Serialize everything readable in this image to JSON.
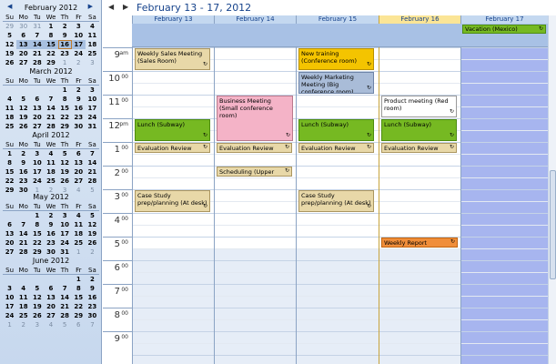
{
  "mini_calendars": [
    {
      "title": "February 2012",
      "dow": [
        "Su",
        "Mo",
        "Tu",
        "We",
        "Th",
        "Fr",
        "Sa"
      ],
      "days": [
        "29",
        "30",
        "31",
        "1",
        "2",
        "3",
        "4",
        "5",
        "6",
        "7",
        "8",
        "9",
        "10",
        "11",
        "12",
        "13",
        "14",
        "15",
        "16",
        "17",
        "18",
        "19",
        "20",
        "21",
        "22",
        "23",
        "24",
        "25",
        "26",
        "27",
        "28",
        "29",
        "1",
        "2",
        "3"
      ],
      "other_month_idx": [
        0,
        1,
        2,
        32,
        33,
        34
      ],
      "selected_idx": [
        15,
        16,
        17,
        18,
        19
      ],
      "today_idx": [
        18
      ]
    },
    {
      "title": "March 2012",
      "dow": [
        "Su",
        "Mo",
        "Tu",
        "We",
        "Th",
        "Fr",
        "Sa"
      ],
      "days": [
        "",
        "",
        "",
        "",
        "1",
        "2",
        "3",
        "4",
        "5",
        "6",
        "7",
        "8",
        "9",
        "10",
        "11",
        "12",
        "13",
        "14",
        "15",
        "16",
        "17",
        "18",
        "19",
        "20",
        "21",
        "22",
        "23",
        "24",
        "25",
        "26",
        "27",
        "28",
        "29",
        "30",
        "31"
      ],
      "other_month_idx": [],
      "selected_idx": [],
      "today_idx": []
    },
    {
      "title": "April 2012",
      "dow": [
        "Su",
        "Mo",
        "Tu",
        "We",
        "Th",
        "Fr",
        "Sa"
      ],
      "days": [
        "1",
        "2",
        "3",
        "4",
        "5",
        "6",
        "7",
        "8",
        "9",
        "10",
        "11",
        "12",
        "13",
        "14",
        "15",
        "16",
        "17",
        "18",
        "19",
        "20",
        "21",
        "22",
        "23",
        "24",
        "25",
        "26",
        "27",
        "28",
        "29",
        "30",
        "1",
        "2",
        "3",
        "4",
        "5"
      ],
      "other_month_idx": [
        30,
        31,
        32,
        33,
        34
      ],
      "selected_idx": [],
      "today_idx": []
    },
    {
      "title": "May 2012",
      "dow": [
        "Su",
        "Mo",
        "Tu",
        "We",
        "Th",
        "Fr",
        "Sa"
      ],
      "days": [
        "",
        "",
        "1",
        "2",
        "3",
        "4",
        "5",
        "6",
        "7",
        "8",
        "9",
        "10",
        "11",
        "12",
        "13",
        "14",
        "15",
        "16",
        "17",
        "18",
        "19",
        "20",
        "21",
        "22",
        "23",
        "24",
        "25",
        "26",
        "27",
        "28",
        "29",
        "30",
        "31",
        "1",
        "2"
      ],
      "other_month_idx": [
        33,
        34
      ],
      "selected_idx": [],
      "today_idx": []
    },
    {
      "title": "June 2012",
      "dow": [
        "Su",
        "Mo",
        "Tu",
        "We",
        "Th",
        "Fr",
        "Sa"
      ],
      "days": [
        "",
        "",
        "",
        "",
        "",
        "1",
        "2",
        "3",
        "4",
        "5",
        "6",
        "7",
        "8",
        "9",
        "10",
        "11",
        "12",
        "13",
        "14",
        "15",
        "16",
        "17",
        "18",
        "19",
        "20",
        "21",
        "22",
        "23",
        "24",
        "25",
        "26",
        "27",
        "28",
        "29",
        "30",
        "1",
        "2",
        "3",
        "4",
        "5",
        "6",
        "7"
      ],
      "other_month_idx": [
        35,
        36,
        37,
        38,
        39,
        40,
        41
      ],
      "selected_idx": [],
      "today_idx": []
    }
  ],
  "header": {
    "range": "February 13 - 17, 2012",
    "prev_icon": "prev-arrow-icon",
    "next_icon": "next-arrow-icon"
  },
  "days": [
    {
      "label": "February 13",
      "today": false
    },
    {
      "label": "February 14",
      "today": false
    },
    {
      "label": "February 15",
      "today": false
    },
    {
      "label": "February 16",
      "today": true
    },
    {
      "label": "February 17",
      "today": false
    }
  ],
  "allday_event": {
    "title": "Vacation (Mexico)",
    "day": 4
  },
  "hours": [
    {
      "h": "9",
      "m": "am"
    },
    {
      "h": "10",
      "m": "00"
    },
    {
      "h": "11",
      "m": "00"
    },
    {
      "h": "12",
      "m": "pm"
    },
    {
      "h": "1",
      "m": "00"
    },
    {
      "h": "2",
      "m": "00"
    },
    {
      "h": "3",
      "m": "00"
    },
    {
      "h": "4",
      "m": "00"
    },
    {
      "h": "5",
      "m": "00"
    },
    {
      "h": "6",
      "m": "00"
    },
    {
      "h": "7",
      "m": "00"
    },
    {
      "h": "8",
      "m": "00"
    },
    {
      "h": "9",
      "m": "00"
    }
  ],
  "events": [
    {
      "day": 0,
      "start": 9.0,
      "end": 10.0,
      "title": "Weekly Sales Meeting (Sales Room)",
      "color": "tan"
    },
    {
      "day": 0,
      "start": 12.0,
      "end": 13.0,
      "title": "Lunch (Subway)",
      "color": "green"
    },
    {
      "day": 0,
      "start": 13.0,
      "end": 13.5,
      "title": "Evaluation Review",
      "color": "tan"
    },
    {
      "day": 0,
      "start": 15.0,
      "end": 16.0,
      "title": "Case Study prep/planning (At desk)",
      "color": "tan"
    },
    {
      "day": 1,
      "start": 11.0,
      "end": 13.0,
      "title": "Business Meeting (Small conference room)",
      "color": "pink"
    },
    {
      "day": 1,
      "start": 13.0,
      "end": 13.5,
      "title": "Evaluation Review",
      "color": "tan"
    },
    {
      "day": 1,
      "start": 14.0,
      "end": 14.5,
      "title": "Scheduling (Upper deck)",
      "color": "tan"
    },
    {
      "day": 2,
      "start": 9.0,
      "end": 10.0,
      "title": "New training (Conference room)",
      "color": "yellow"
    },
    {
      "day": 2,
      "start": 10.0,
      "end": 11.0,
      "title": "Weekly Marketing Meeting (Big conference room)",
      "color": "blue"
    },
    {
      "day": 2,
      "start": 12.0,
      "end": 13.0,
      "title": "Lunch (Subway)",
      "color": "green"
    },
    {
      "day": 2,
      "start": 13.0,
      "end": 13.5,
      "title": "Evaluation Review",
      "color": "tan"
    },
    {
      "day": 2,
      "start": 15.0,
      "end": 16.0,
      "title": "Case Study prep/planning (At desk)",
      "color": "tan"
    },
    {
      "day": 3,
      "start": 11.0,
      "end": 12.0,
      "title": "Product meeting (Red room)",
      "color": "white"
    },
    {
      "day": 3,
      "start": 12.0,
      "end": 13.0,
      "title": "Lunch (Subway)",
      "color": "green"
    },
    {
      "day": 3,
      "start": 13.0,
      "end": 13.5,
      "title": "Evaluation Review",
      "color": "tan"
    },
    {
      "day": 3,
      "start": 17.0,
      "end": 17.5,
      "title": "Weekly Report",
      "color": "orange"
    }
  ]
}
